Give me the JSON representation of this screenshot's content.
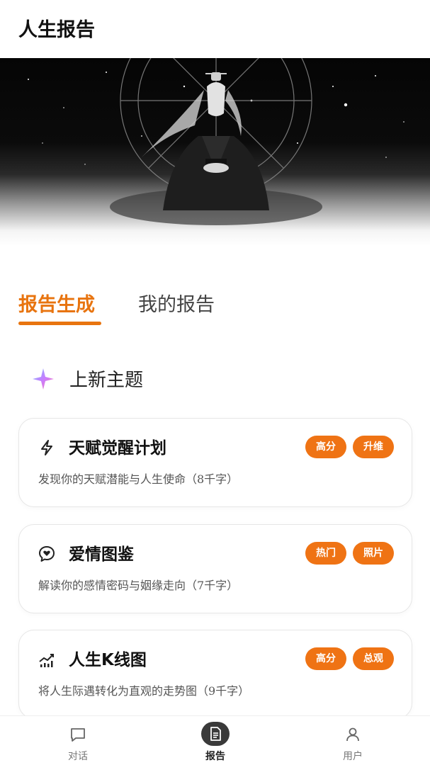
{
  "header": {
    "title": "人生报告"
  },
  "hero": {
    "image": "meditating-figure-zodiac-wheel"
  },
  "tabs": [
    {
      "label": "报告生成",
      "active": true
    },
    {
      "label": "我的报告",
      "active": false
    }
  ],
  "section": {
    "title": "上新主题",
    "icon": "sparkle-star-icon"
  },
  "cards": [
    {
      "title": "天赋觉醒计划",
      "desc": "发现你的天赋潜能与人生使命（8千字）",
      "icon": "lightning-icon",
      "badges": [
        "高分",
        "升维"
      ]
    },
    {
      "title": "爱情图鉴",
      "desc": "解读你的感情密码与姻缘走向（7千字）",
      "icon": "heart-chat-icon",
      "badges": [
        "热门",
        "照片"
      ]
    },
    {
      "title": "人生K线图",
      "desc": "将人生际遇转化为直观的走势图（9千字）",
      "icon": "trend-chart-icon",
      "badges": [
        "高分",
        "总观"
      ]
    }
  ],
  "nav": [
    {
      "label": "对话",
      "icon": "chat-icon",
      "active": false
    },
    {
      "label": "报告",
      "icon": "document-icon",
      "active": true
    },
    {
      "label": "用户",
      "icon": "user-icon",
      "active": false
    }
  ],
  "colors": {
    "accent": "#e8740f",
    "badge": "#ef7314"
  }
}
